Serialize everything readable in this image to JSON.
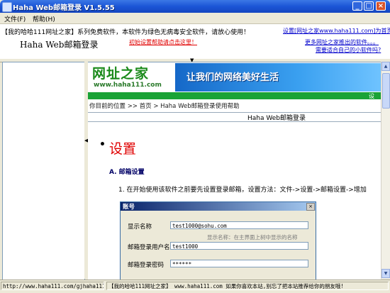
{
  "window": {
    "title": "Haha Web邮箱登录 V1.5.55",
    "controls": {
      "minimize": "_",
      "maximize": "□",
      "close": "×"
    }
  },
  "menu": {
    "items": [
      "文件(F)",
      "帮助(H)"
    ]
  },
  "ad": {
    "line1_prefix": "【我的哈哈111网址之家】系列免费软件，本软件为绿色无病毒安全软件，请放心使用！",
    "setup_link": "设置[网址之家www.haha111.com]为首页",
    "app_heading": "Haha Web邮箱登录",
    "help_link": "初始设置帮助请点击这里！",
    "more_software_link": "更多网址之家推出的软件。。。",
    "need_software_link": "需要适合自己的小软件吗?"
  },
  "browser": {
    "logo_text": "网址之家",
    "logo_url": "www.haha111.com",
    "slogan": "让我们的网络美好生活",
    "green_bar_text": "设",
    "breadcrumb": "你目前的位置 >> 首页 > Haha Web邮箱登录使用帮助",
    "page_header": "Haha Web邮箱登录",
    "bullet": "•",
    "section_title": "设置",
    "subsection_title": "A. 邮箱设置",
    "step_1": "1. 在开始使用该软件之前要先设置登录邮箱，设置方法：文件->设置->邮箱设置->增加"
  },
  "dialog": {
    "title": "账号",
    "close_label": "×",
    "display_name_label": "显示名称",
    "display_name_value": "test1000@sohu.com",
    "display_name_hint": "显示名称：在主界面上树中显示的名称",
    "login_user_label": "邮箱登录用户名",
    "login_user_value": "test1000",
    "password_label": "邮箱登录密码",
    "password_value": "******"
  },
  "status": {
    "cell1": "http://www.haha111.com/gjhaha111/g",
    "cell2": "【我的哈哈111网址之家】 www.haha111.com 如果你喜欢本站,别忘了把本站推荐给你的朋友哦!"
  },
  "colors": {
    "title_bar": "#1b55d6",
    "close_button": "#d9542a",
    "section_title": "#e00000",
    "green_bar": "#1aa336",
    "link": "#0000cc"
  }
}
